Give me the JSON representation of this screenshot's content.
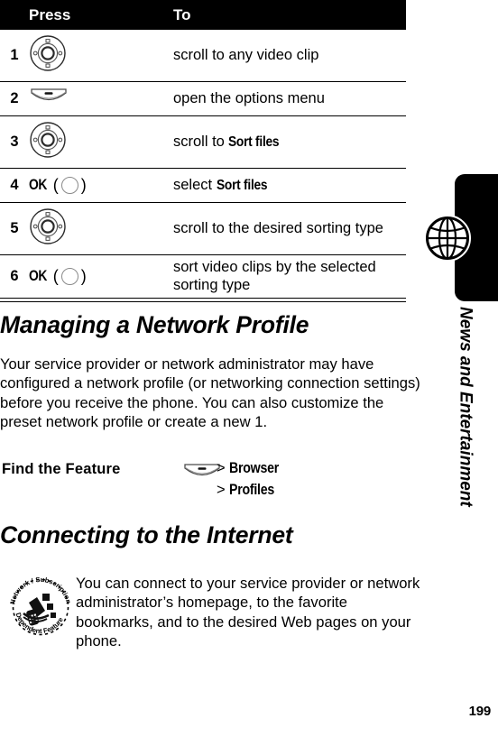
{
  "document": {
    "page_number": "199",
    "sidebar_label": "News and Entertainment",
    "sidebar_icon": "globe-icon"
  },
  "steps_table": {
    "headers": {
      "number": "",
      "press": "Press",
      "to": "To"
    },
    "rows": [
      {
        "number": "1",
        "press_icon": "navigation-key-icon",
        "press_text": "",
        "to_prefix": "scroll to any video clip",
        "to_bold": "",
        "to_suffix": ""
      },
      {
        "number": "2",
        "press_icon": "menu-key-icon",
        "press_text": "",
        "to_prefix": "open the options menu",
        "to_bold": "",
        "to_suffix": ""
      },
      {
        "number": "3",
        "press_icon": "navigation-key-icon",
        "press_text": "",
        "to_prefix": "scroll to ",
        "to_bold": "Sort files",
        "to_suffix": ""
      },
      {
        "number": "4",
        "press_icon": "ok-key-icon",
        "press_text": "OK",
        "to_prefix": "select ",
        "to_bold": "Sort files",
        "to_suffix": ""
      },
      {
        "number": "5",
        "press_icon": "navigation-key-icon",
        "press_text": "",
        "to_prefix": "scroll to the desired sorting type",
        "to_bold": "",
        "to_suffix": ""
      },
      {
        "number": "6",
        "press_icon": "ok-key-icon",
        "press_text": "OK",
        "to_prefix": "sort video clips by the selected sorting type",
        "to_bold": "",
        "to_suffix": ""
      }
    ]
  },
  "sections": [
    {
      "heading": "Managing a Network Profile",
      "body": "Your service provider or network administrator may have configured a network profile (or networking connection settings) before you receive the phone. You can also customize the preset network profile or create a new 1."
    },
    {
      "heading": "Connecting to the Internet",
      "body": "You can connect to your service provider or network administrator’s homepage, to the favorite bookmarks, and to the desired Web pages on your phone."
    }
  ],
  "find_the_feature": {
    "label": "Find the Feature",
    "icon": "menu-key-icon",
    "path": [
      {
        "separator": ">",
        "name": "Browser"
      },
      {
        "separator": ">",
        "name": "Profiles"
      }
    ]
  },
  "note": {
    "icon": "network-subscription-dependent-feature-icon",
    "icon_text_top": "Network / Subscription",
    "icon_text_bottom": "Dependent  Feature",
    "text": "You can connect to your service provider or network administrator’s homepage, to the favorite bookmarks, and to the desired Web pages on your phone."
  },
  "colors": {
    "ink": "#000000",
    "paper": "#ffffff",
    "key_outline": "#8a8a8a"
  }
}
